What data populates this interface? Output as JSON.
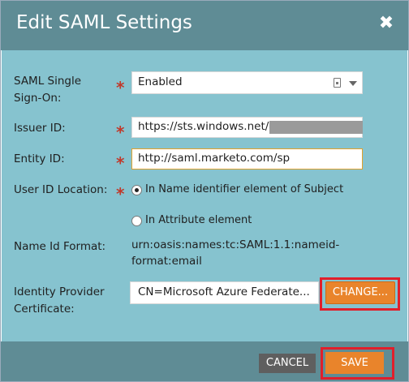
{
  "dialog": {
    "title": "Edit SAML Settings",
    "close_icon": "close-icon"
  },
  "form": {
    "sso_label": "SAML Single Sign-On:",
    "sso_value": "Enabled",
    "issuer_label": "Issuer ID:",
    "issuer_value": "https://sts.windows.net/4",
    "entity_label": "Entity ID:",
    "entity_value": "http://saml.marketo.com/sp",
    "userid_label": "User ID Location:",
    "userid_options": [
      {
        "label": "In Name identifier element of Subject",
        "checked": true
      },
      {
        "label": "In Attribute element",
        "checked": false
      }
    ],
    "nameid_label": "Name Id Format:",
    "nameid_value": "urn:oasis:names:tc:SAML:1.1:nameid-format:email",
    "cert_label": "Identity Provider Certificate:",
    "cert_value": "CN=Microsoft Azure Federate...",
    "change_button": "CHANGE..."
  },
  "footer": {
    "cancel_label": "CANCEL",
    "save_label": "SAVE"
  },
  "colors": {
    "header": "#5f8c95",
    "body": "#86c3cf",
    "accent_orange": "#e9842b",
    "highlight_red": "#e11f2b",
    "required_star": "#c0392b"
  },
  "icons": {
    "lock": "lock-icon",
    "caret": "chevron-down-icon"
  }
}
